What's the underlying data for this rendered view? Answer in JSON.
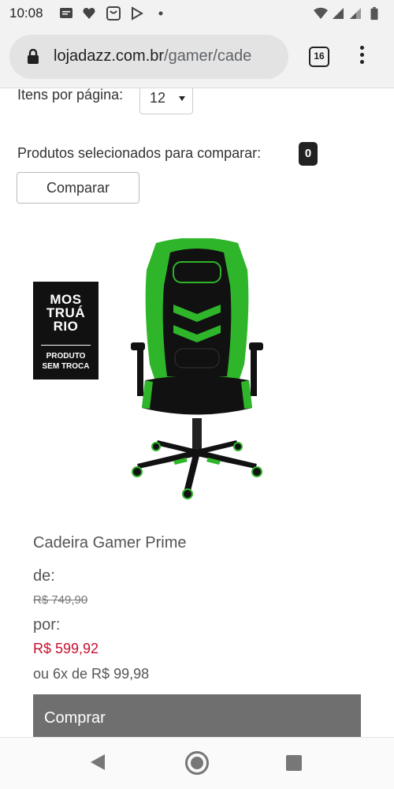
{
  "status_bar": {
    "time": "10:08"
  },
  "browser": {
    "url_domain": "lojadazz.com.br",
    "url_path": "/gamer/cade",
    "tab_count": "16"
  },
  "listing": {
    "per_page_label": "Itens por página:",
    "per_page_value": "12",
    "compare_label": "Produtos selecionados para comparar:",
    "compare_count": "0",
    "compare_button": "Comparar"
  },
  "product": {
    "badge_lines": [
      "MOS",
      "TRUÁ",
      "RIO"
    ],
    "badge_sub_1": "PRODUTO",
    "badge_sub_2": "SEM TROCA",
    "name": "Cadeira Gamer Prime",
    "price_from_label": "de:",
    "price_old": "R$ 749,90",
    "price_by_label": "por:",
    "price_new": "R$ 599,92",
    "installments": "ou 6x de R$ 99,98",
    "buy_button": "Comprar"
  },
  "colors": {
    "chair_green": "#2fb52a",
    "chair_black": "#111111",
    "price_red": "#c8102e",
    "buy_button_bg": "#6f6f6f"
  }
}
